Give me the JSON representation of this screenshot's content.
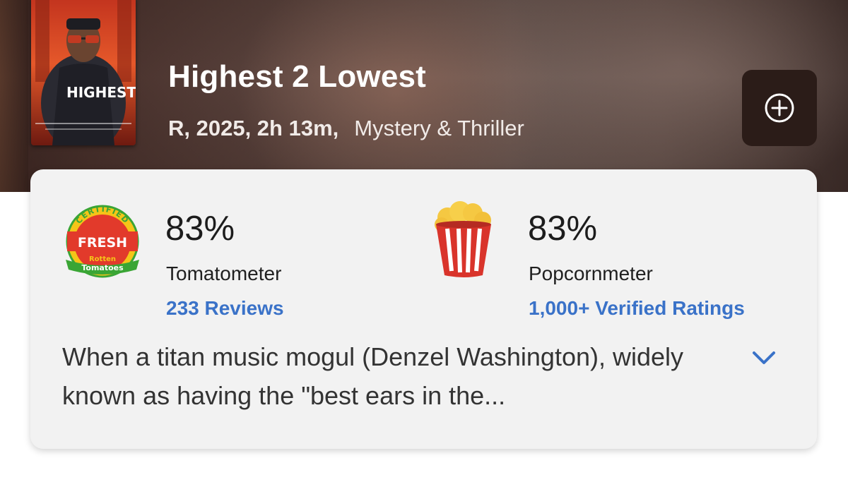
{
  "movie": {
    "title": "Highest 2 Lowest",
    "info": "R, 2025, 2h 13m,",
    "genre": "Mystery & Thriller",
    "poster_text": "HIGHEST LOWEST"
  },
  "tomatometer": {
    "badge_icon": "certified-fresh-icon",
    "badge_text": [
      "CERTIFIED",
      "FRESH",
      "Rotten",
      "Tomatoes"
    ],
    "score": "83%",
    "label": "Tomatometer",
    "reviews_link": "233 Reviews"
  },
  "popcornmeter": {
    "badge_icon": "popcorn-bucket-icon",
    "score": "83%",
    "label": "Popcornmeter",
    "ratings_link": "1,000+ Verified Ratings"
  },
  "synopsis": {
    "text": "When a titan music mogul (Denzel Washington), widely known as having the \"best ears in the...",
    "expand_icon": "chevron-down-icon"
  },
  "actions": {
    "add_icon": "plus-circle-icon"
  },
  "colors": {
    "link": "#3a72c8",
    "card_bg": "#f2f2f2",
    "fresh_red": "#e23a2b",
    "badge_yellow": "#f5c518",
    "badge_green": "#3aa535",
    "popcorn_red": "#d9342b"
  }
}
